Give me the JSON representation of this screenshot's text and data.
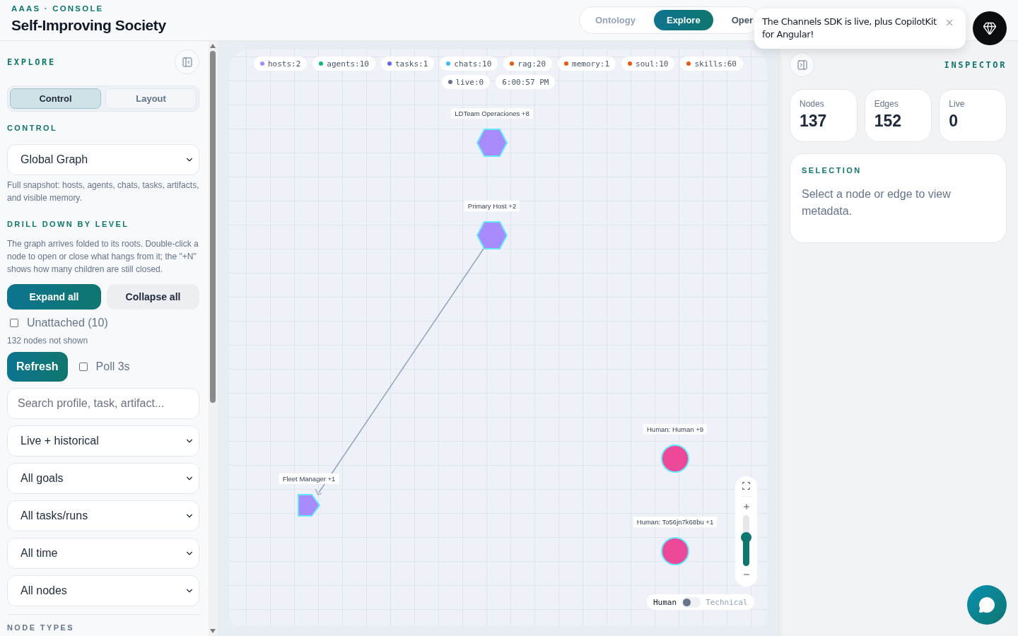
{
  "header": {
    "eyebrow": "AAAS · CONSOLE",
    "title": "Self-Improving Society",
    "tabs": [
      {
        "label": "Ontology",
        "selected": false
      },
      {
        "label": "Explore",
        "selected": true
      },
      {
        "label": "Oper",
        "selected": false
      }
    ]
  },
  "toast": {
    "message": "The Channels SDK is live, plus CopilotKit for Angular!"
  },
  "sidebar": {
    "heading": "EXPLORE",
    "modes": [
      {
        "label": "Control",
        "selected": true
      },
      {
        "label": "Layout",
        "selected": false
      }
    ],
    "control_heading": "CONTROL",
    "view_select": "Global Graph",
    "view_help": "Full snapshot: hosts, agents, chats, tasks, artifacts, and visible memory.",
    "drill_heading": "DRILL DOWN BY LEVEL",
    "drill_help": "The graph arrives folded to its roots. Double-click a node to open or close what hangs from it; the \"+N\" shows how many children are still closed.",
    "expand_button": "Expand all",
    "collapse_button": "Collapse all",
    "unattached": {
      "label": "Unattached (10)",
      "checked": false
    },
    "hidden_note": "132 nodes not shown",
    "refresh_button": "Refresh",
    "poll": {
      "label": "Poll 3s",
      "checked": false
    },
    "search": {
      "placeholder": "Search profile, task, artifact..."
    },
    "filters": [
      "Live + historical",
      "All goals",
      "All tasks/runs",
      "All time",
      "All nodes"
    ],
    "node_types_heading": "NODE TYPES"
  },
  "canvas": {
    "chips": [
      {
        "label": "hosts:2",
        "color": "#a78bfa"
      },
      {
        "label": "agents:10",
        "color": "#10b981"
      },
      {
        "label": "tasks:1",
        "color": "#6366f1"
      },
      {
        "label": "chats:10",
        "color": "#38bdf8"
      },
      {
        "label": "rag:20",
        "color": "#ea580c"
      },
      {
        "label": "memory:1",
        "color": "#ea580c"
      },
      {
        "label": "soul:10",
        "color": "#ea580c"
      },
      {
        "label": "skills:60",
        "color": "#ea580c"
      },
      {
        "label": "live:0",
        "color": "#6b7280"
      },
      {
        "label": "6:00:57 PM"
      }
    ],
    "nodes": [
      {
        "label": "LDTeam Operaciones +8",
        "kind": "hexagon",
        "color": "#a78bfa"
      },
      {
        "label": "Primary Host +2",
        "kind": "hexagon",
        "color": "#a78bfa"
      },
      {
        "label": "Fleet Manager +1",
        "kind": "pentagon",
        "color": "#a78bfa"
      },
      {
        "label": "Human: Human +9",
        "kind": "circle",
        "color": "#ec4899"
      },
      {
        "label": "Human: To56jn7k68bu +1",
        "kind": "circle",
        "color": "#ec4899"
      }
    ],
    "zoom": {
      "level": 0.55
    },
    "view_mode": [
      {
        "label": "Human",
        "selected": true
      },
      {
        "label": "Technical",
        "selected": false
      }
    ]
  },
  "inspector": {
    "heading": "INSPECTOR",
    "stats": [
      {
        "label": "Nodes",
        "value": "137"
      },
      {
        "label": "Edges",
        "value": "152"
      },
      {
        "label": "Live",
        "value": "0"
      }
    ],
    "selection": {
      "heading": "SELECTION",
      "message": "Select a node or edge to view metadata."
    }
  }
}
